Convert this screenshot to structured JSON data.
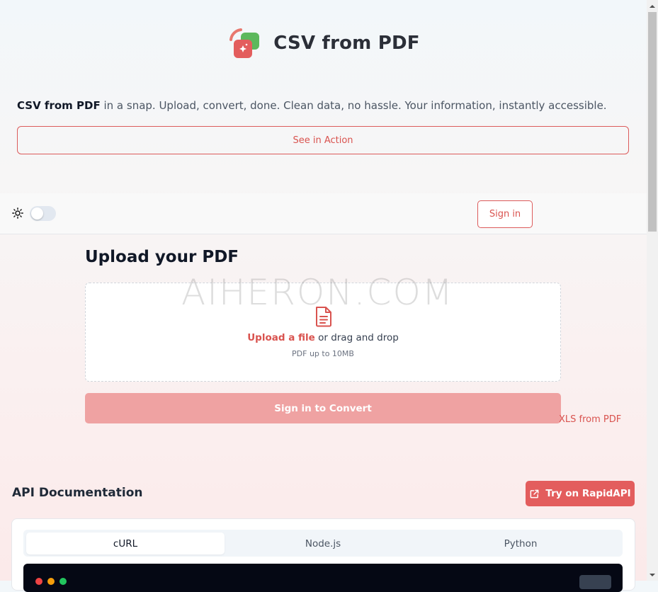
{
  "brand": {
    "title": "CSV from PDF"
  },
  "hero": {
    "tagline_bold": "CSV from PDF",
    "tagline_rest": " in a snap. Upload, convert, done. Clean data, no hassle. Your information, instantly accessible.",
    "action_label": "See in Action"
  },
  "toolbar": {
    "theme_icon": "sun-icon",
    "theme_toggle_on": false,
    "signin_label": "Sign in"
  },
  "upload": {
    "title": "Upload your PDF",
    "link_label": "Upload a file",
    "drag_text": " or drag and drop",
    "hint": "PDF up to 10MB",
    "convert_label": "Sign in to Convert",
    "watermark": "AIHERON.COM"
  },
  "xls_link": "XLS from PDF",
  "api": {
    "title": "API Documentation",
    "rapid_label": "Try on RapidAPI",
    "tabs": [
      {
        "label": "cURL",
        "active": true
      },
      {
        "label": "Node.js",
        "active": false
      },
      {
        "label": "Python",
        "active": false
      }
    ]
  },
  "colors": {
    "accent": "#d9534f",
    "accent_button": "#e35d5d",
    "disabled_button": "#efa2a2",
    "logo_green": "#5cb85c",
    "code_bg": "#050814"
  }
}
